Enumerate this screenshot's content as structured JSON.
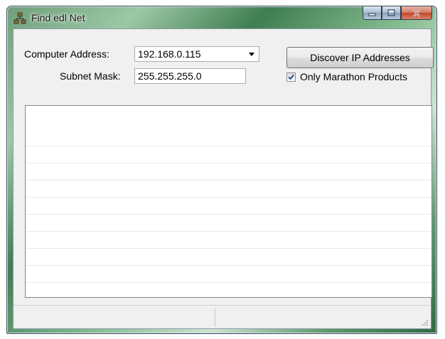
{
  "window": {
    "title": "Find edl Net",
    "icon": "network-icon",
    "caption_buttons": [
      "minimize-icon",
      "maximize-icon",
      "close-icon"
    ]
  },
  "form": {
    "computer_address_label": "Computer Address:",
    "computer_address_value": "192.168.0.115",
    "subnet_mask_label": "Subnet Mask:",
    "subnet_mask_value": "255.255.255.0",
    "discover_button_label": "Discover IP Addresses",
    "only_marathon_label": "Only Marathon Products",
    "only_marathon_checked": true
  },
  "results_list": {
    "rows": []
  },
  "statusbar": {
    "left_text": "",
    "right_text": ""
  }
}
